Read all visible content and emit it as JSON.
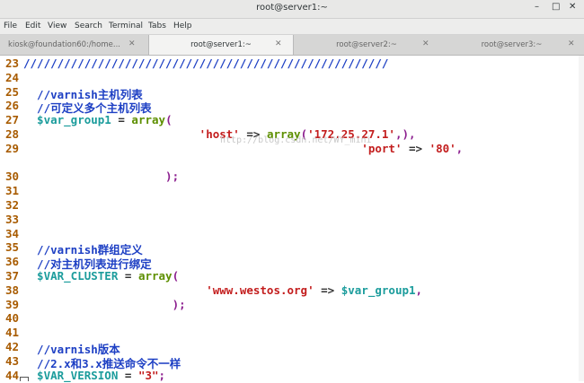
{
  "window": {
    "title": "root@server1:~",
    "min": "–",
    "max": "□",
    "close": "✕"
  },
  "menu": [
    "File",
    "Edit",
    "View",
    "Search",
    "Terminal",
    "Tabs",
    "Help"
  ],
  "tabs": [
    {
      "label": "kiosk@foundation60:/home...",
      "close": "✕",
      "active": false
    },
    {
      "label": "root@server1:~",
      "close": "✕",
      "active": true
    },
    {
      "label": "root@server2:~",
      "close": "✕",
      "active": false
    },
    {
      "label": "root@server3:~",
      "close": "✕",
      "active": false
    }
  ],
  "lines": [
    {
      "n": "23",
      "tokens": [
        {
          "t": "//////////////////////////////////////////////////////",
          "c": "c-comment"
        }
      ]
    },
    {
      "n": "24",
      "tokens": []
    },
    {
      "n": "25",
      "tokens": [
        {
          "t": "  //varnish主机列表",
          "c": "c-comment"
        }
      ]
    },
    {
      "n": "26",
      "tokens": [
        {
          "t": "  //可定义多个主机列表",
          "c": "c-comment"
        }
      ]
    },
    {
      "n": "27",
      "tokens": [
        {
          "t": "  $var_group1",
          "c": "c-var"
        },
        {
          "t": " = ",
          "c": "c-plain"
        },
        {
          "t": "array",
          "c": "c-key"
        },
        {
          "t": "(",
          "c": "c-punc"
        }
      ]
    },
    {
      "n": "28",
      "tokens": [
        {
          "t": "                          ",
          "c": "c-plain"
        },
        {
          "t": "'host'",
          "c": "c-str"
        },
        {
          "t": " => ",
          "c": "c-plain"
        },
        {
          "t": "array",
          "c": "c-key"
        },
        {
          "t": "(",
          "c": "c-punc"
        },
        {
          "t": "'172.25.27.1'",
          "c": "c-str"
        },
        {
          "t": ",),",
          "c": "c-punc"
        }
      ]
    },
    {
      "n": "29",
      "tokens": [
        {
          "t": "                                                  ",
          "c": "c-plain"
        },
        {
          "t": "'port'",
          "c": "c-str"
        },
        {
          "t": " => ",
          "c": "c-plain"
        },
        {
          "t": "'80'",
          "c": "c-str"
        },
        {
          "t": ",",
          "c": "c-punc"
        }
      ]
    },
    {
      "n": "",
      "tokens": []
    },
    {
      "n": "30",
      "tokens": [
        {
          "t": "                     ",
          "c": "c-plain"
        },
        {
          "t": ");",
          "c": "c-punc"
        }
      ]
    },
    {
      "n": "31",
      "tokens": []
    },
    {
      "n": "32",
      "tokens": []
    },
    {
      "n": "33",
      "tokens": []
    },
    {
      "n": "34",
      "tokens": []
    },
    {
      "n": "35",
      "tokens": [
        {
          "t": "  //varnish群组定义",
          "c": "c-comment"
        }
      ]
    },
    {
      "n": "36",
      "tokens": [
        {
          "t": "  //对主机列表进行绑定",
          "c": "c-comment"
        }
      ]
    },
    {
      "n": "37",
      "tokens": [
        {
          "t": "  $VAR_CLUSTER",
          "c": "c-var"
        },
        {
          "t": " = ",
          "c": "c-plain"
        },
        {
          "t": "array",
          "c": "c-key"
        },
        {
          "t": "(",
          "c": "c-punc"
        }
      ]
    },
    {
      "n": "38",
      "tokens": [
        {
          "t": "                           ",
          "c": "c-plain"
        },
        {
          "t": "'www.westos.org'",
          "c": "c-str"
        },
        {
          "t": " => ",
          "c": "c-plain"
        },
        {
          "t": "$var_group1",
          "c": "c-var"
        },
        {
          "t": ",",
          "c": "c-punc"
        }
      ]
    },
    {
      "n": "39",
      "tokens": [
        {
          "t": "                      ",
          "c": "c-plain"
        },
        {
          "t": ");",
          "c": "c-punc"
        }
      ]
    },
    {
      "n": "40",
      "tokens": []
    },
    {
      "n": "41",
      "tokens": []
    },
    {
      "n": "42",
      "tokens": [
        {
          "t": "  //varnish版本",
          "c": "c-comment"
        }
      ]
    },
    {
      "n": "43",
      "tokens": [
        {
          "t": "  //2.x和3.x推送命令不一样",
          "c": "c-comment"
        }
      ]
    },
    {
      "n": "44",
      "tokens": [
        {
          "t": "  $VAR_VERSION",
          "c": "c-var"
        },
        {
          "t": " = ",
          "c": "c-plain"
        },
        {
          "t": "\"3\"",
          "c": "c-str"
        },
        {
          "t": ";",
          "c": "c-punc"
        }
      ]
    }
  ],
  "watermark": "http://blog.csdn.net/WY_mini"
}
